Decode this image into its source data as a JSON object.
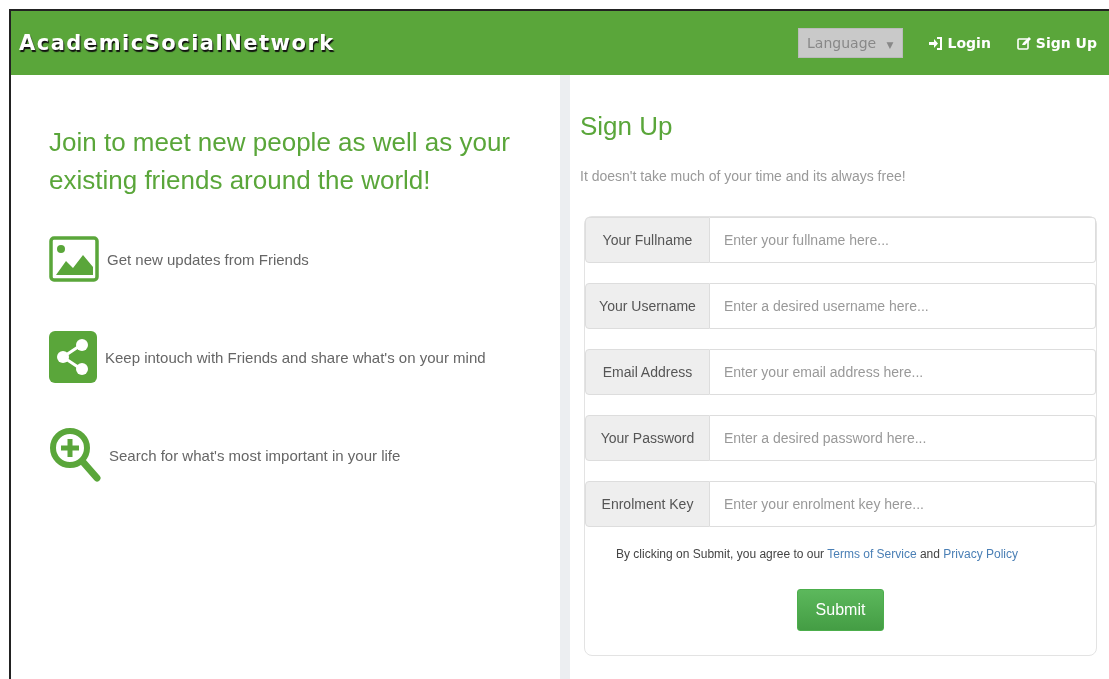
{
  "header": {
    "logo": "AcademicSocialNetwork",
    "language": {
      "label": "Language",
      "caret": "▼"
    },
    "nav": [
      {
        "kind": "login",
        "label": "Login"
      },
      {
        "kind": "signup",
        "label": "Sign Up"
      }
    ]
  },
  "intro": {
    "headline": "Join to meet new people as well as your existing friends around the world!",
    "features": [
      {
        "kind": "image",
        "text": "Get new updates from Friends"
      },
      {
        "kind": "share",
        "text": "Keep intouch with Friends and share what's on your mind"
      },
      {
        "kind": "search",
        "text": "Search for what's most important in your life"
      }
    ]
  },
  "signup": {
    "title": "Sign Up",
    "subtitle": "It doesn't take much of your time and its always free!",
    "fields": [
      {
        "label": "Your Fullname",
        "placeholder": "Enter your fullname here..."
      },
      {
        "label": "Your Username",
        "placeholder": "Enter a desired username here..."
      },
      {
        "label": "Email Address",
        "placeholder": "Enter your email address here..."
      },
      {
        "label": "Your Password",
        "placeholder": "Enter a desired password here..."
      },
      {
        "label": "Enrolment Key",
        "placeholder": "Enter your enrolment key here..."
      }
    ],
    "agreement": {
      "before": "By clicking on Submit, you agree to our",
      "terms": "Terms of Service",
      "middle": "and",
      "privacy": "Privacy Policy"
    },
    "submit": "Submit"
  }
}
